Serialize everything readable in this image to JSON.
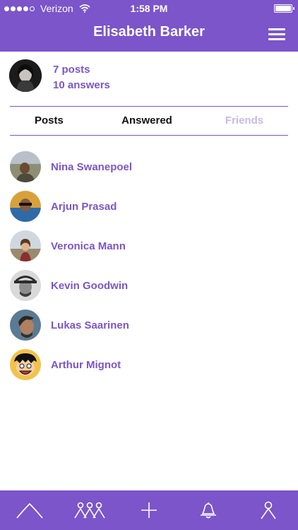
{
  "status_bar": {
    "carrier": "Verizon",
    "time": "1:58 PM"
  },
  "header": {
    "title": "Elisabeth Barker"
  },
  "profile": {
    "posts": "7 posts",
    "answers": "10 answers"
  },
  "tabs": [
    {
      "label": "Posts"
    },
    {
      "label": "Answered"
    },
    {
      "label": "Friends"
    }
  ],
  "friends": [
    {
      "name": "Nina Swanepoel"
    },
    {
      "name": "Arjun Prasad"
    },
    {
      "name": "Veronica Mann"
    },
    {
      "name": "Kevin Goodwin"
    },
    {
      "name": "Lukas Saarinen"
    },
    {
      "name": "Arthur Mignot"
    }
  ],
  "colors": {
    "accent": "#7b55c9",
    "inactive_tab": "#c9b8e9"
  },
  "bottom_nav": [
    {
      "icon": "mountain-icon"
    },
    {
      "icon": "group-icon"
    },
    {
      "icon": "plus-icon"
    },
    {
      "icon": "bell-icon"
    },
    {
      "icon": "profile-icon"
    }
  ]
}
